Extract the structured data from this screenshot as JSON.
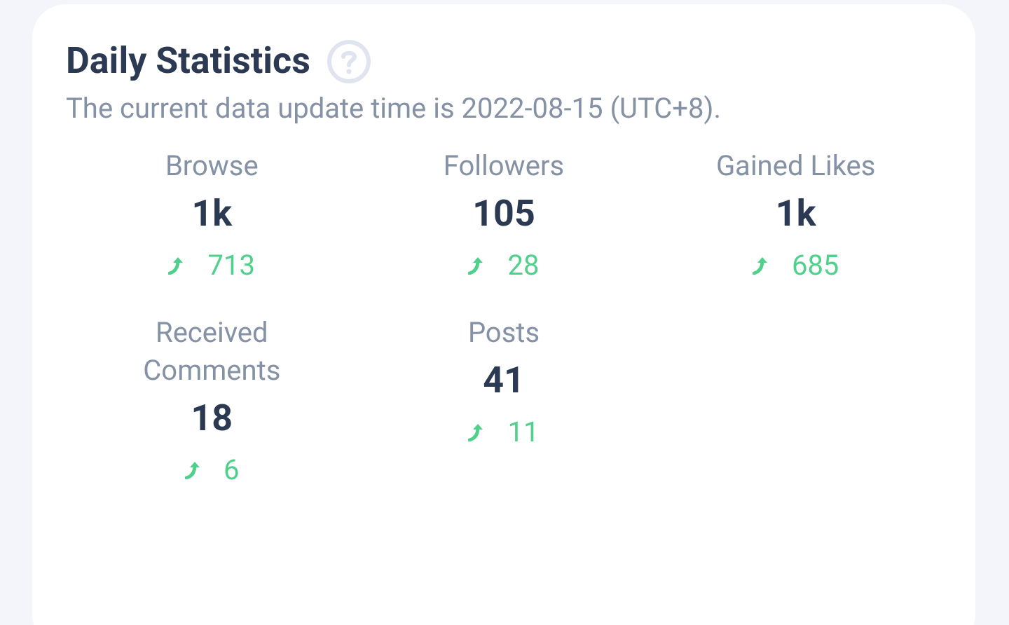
{
  "card": {
    "title": "Daily Statistics",
    "subtitle": "The current data update time is 2022-08-15 (UTC+8).",
    "stats": [
      {
        "label": "Browse",
        "value": "1k",
        "change": "713"
      },
      {
        "label": "Followers",
        "value": "105",
        "change": "28"
      },
      {
        "label": "Gained Likes",
        "value": "1k",
        "change": "685"
      },
      {
        "label": "Received Comments",
        "value": "18",
        "change": "6"
      },
      {
        "label": "Posts",
        "value": "41",
        "change": "11"
      }
    ]
  }
}
